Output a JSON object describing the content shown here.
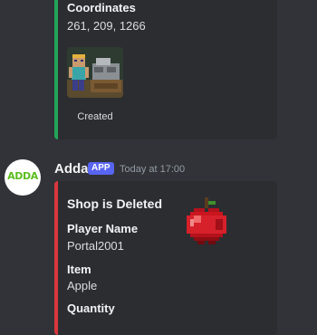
{
  "message1": {
    "accent_color": "#23a55a",
    "fields": {
      "coordinates": {
        "name": "Coordinates",
        "value": "261, 209, 1266"
      }
    },
    "thumbnail": {
      "icon": "minecraft-shop-thumbnail-icon",
      "caption": "Created"
    }
  },
  "message2": {
    "author": {
      "avatar_text": "ADDA",
      "username": "Adda",
      "badge": "APP",
      "timestamp": "Today at 17:00"
    },
    "embed": {
      "accent_color": "#da373c",
      "title": "Shop is Deleted",
      "thumbnail_icon": "apple-icon",
      "fields": {
        "player": {
          "name": "Player Name",
          "value": "Portal2001"
        },
        "item": {
          "name": "Item",
          "value": "Apple"
        },
        "quantity": {
          "name": "Quantity",
          "value": ""
        }
      }
    }
  }
}
